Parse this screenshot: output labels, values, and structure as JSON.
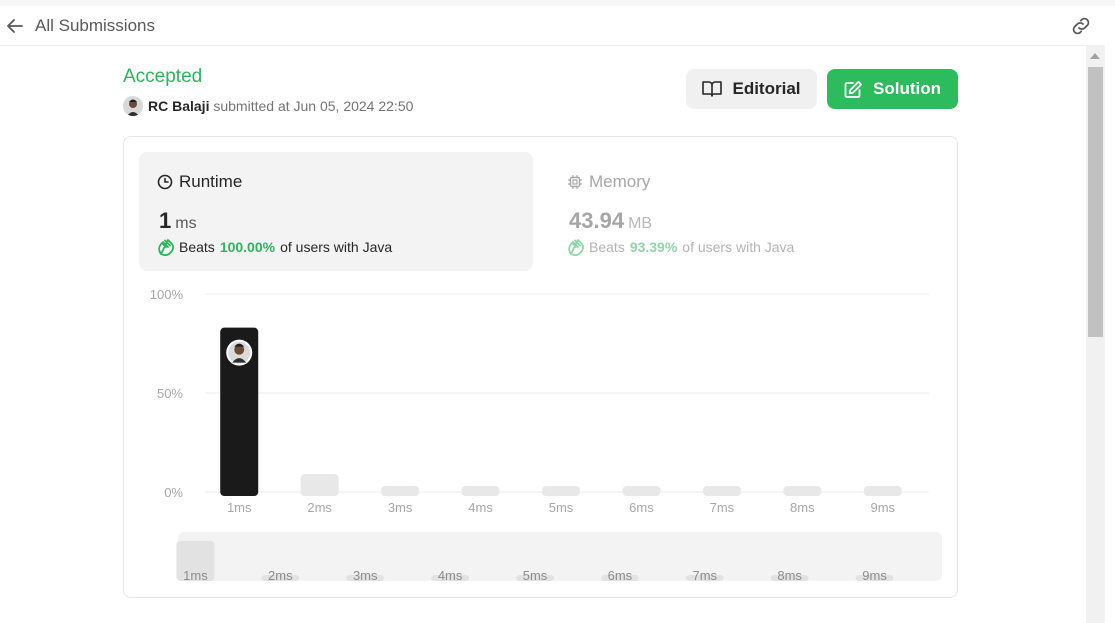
{
  "header": {
    "title": "All Submissions",
    "back_icon": "arrow-left-icon",
    "link_icon": "link-icon"
  },
  "submission": {
    "status": "Accepted",
    "user": "RC Balaji",
    "submitted_text": "submitted at Jun 05, 2024 22:50"
  },
  "actions": {
    "editorial_label": "Editorial",
    "solution_label": "Solution"
  },
  "runtime": {
    "title": "Runtime",
    "value": "1",
    "unit": "ms",
    "beats_label": "Beats",
    "beats_pct": "100.00%",
    "beats_suffix": "of users with Java"
  },
  "memory": {
    "title": "Memory",
    "value": "43.94",
    "unit": "MB",
    "beats_label": "Beats",
    "beats_pct": "93.39%",
    "beats_suffix": "of users with Java"
  },
  "colors": {
    "accent_green": "#2db55d",
    "bar_selected": "#1a1a1a",
    "bar_default": "#e8e8e8"
  },
  "chart_data": {
    "type": "bar",
    "categories": [
      "1ms",
      "2ms",
      "3ms",
      "4ms",
      "5ms",
      "6ms",
      "7ms",
      "8ms",
      "9ms"
    ],
    "values": [
      83,
      9,
      3,
      3,
      3,
      3,
      3,
      3,
      3
    ],
    "selected": "1ms",
    "y_ticks": [
      "100%",
      "50%",
      "0%"
    ],
    "ylim": [
      0,
      100
    ],
    "grid": true,
    "mini_values": [
      20,
      3,
      3,
      3,
      3,
      3,
      3,
      3,
      3
    ]
  }
}
